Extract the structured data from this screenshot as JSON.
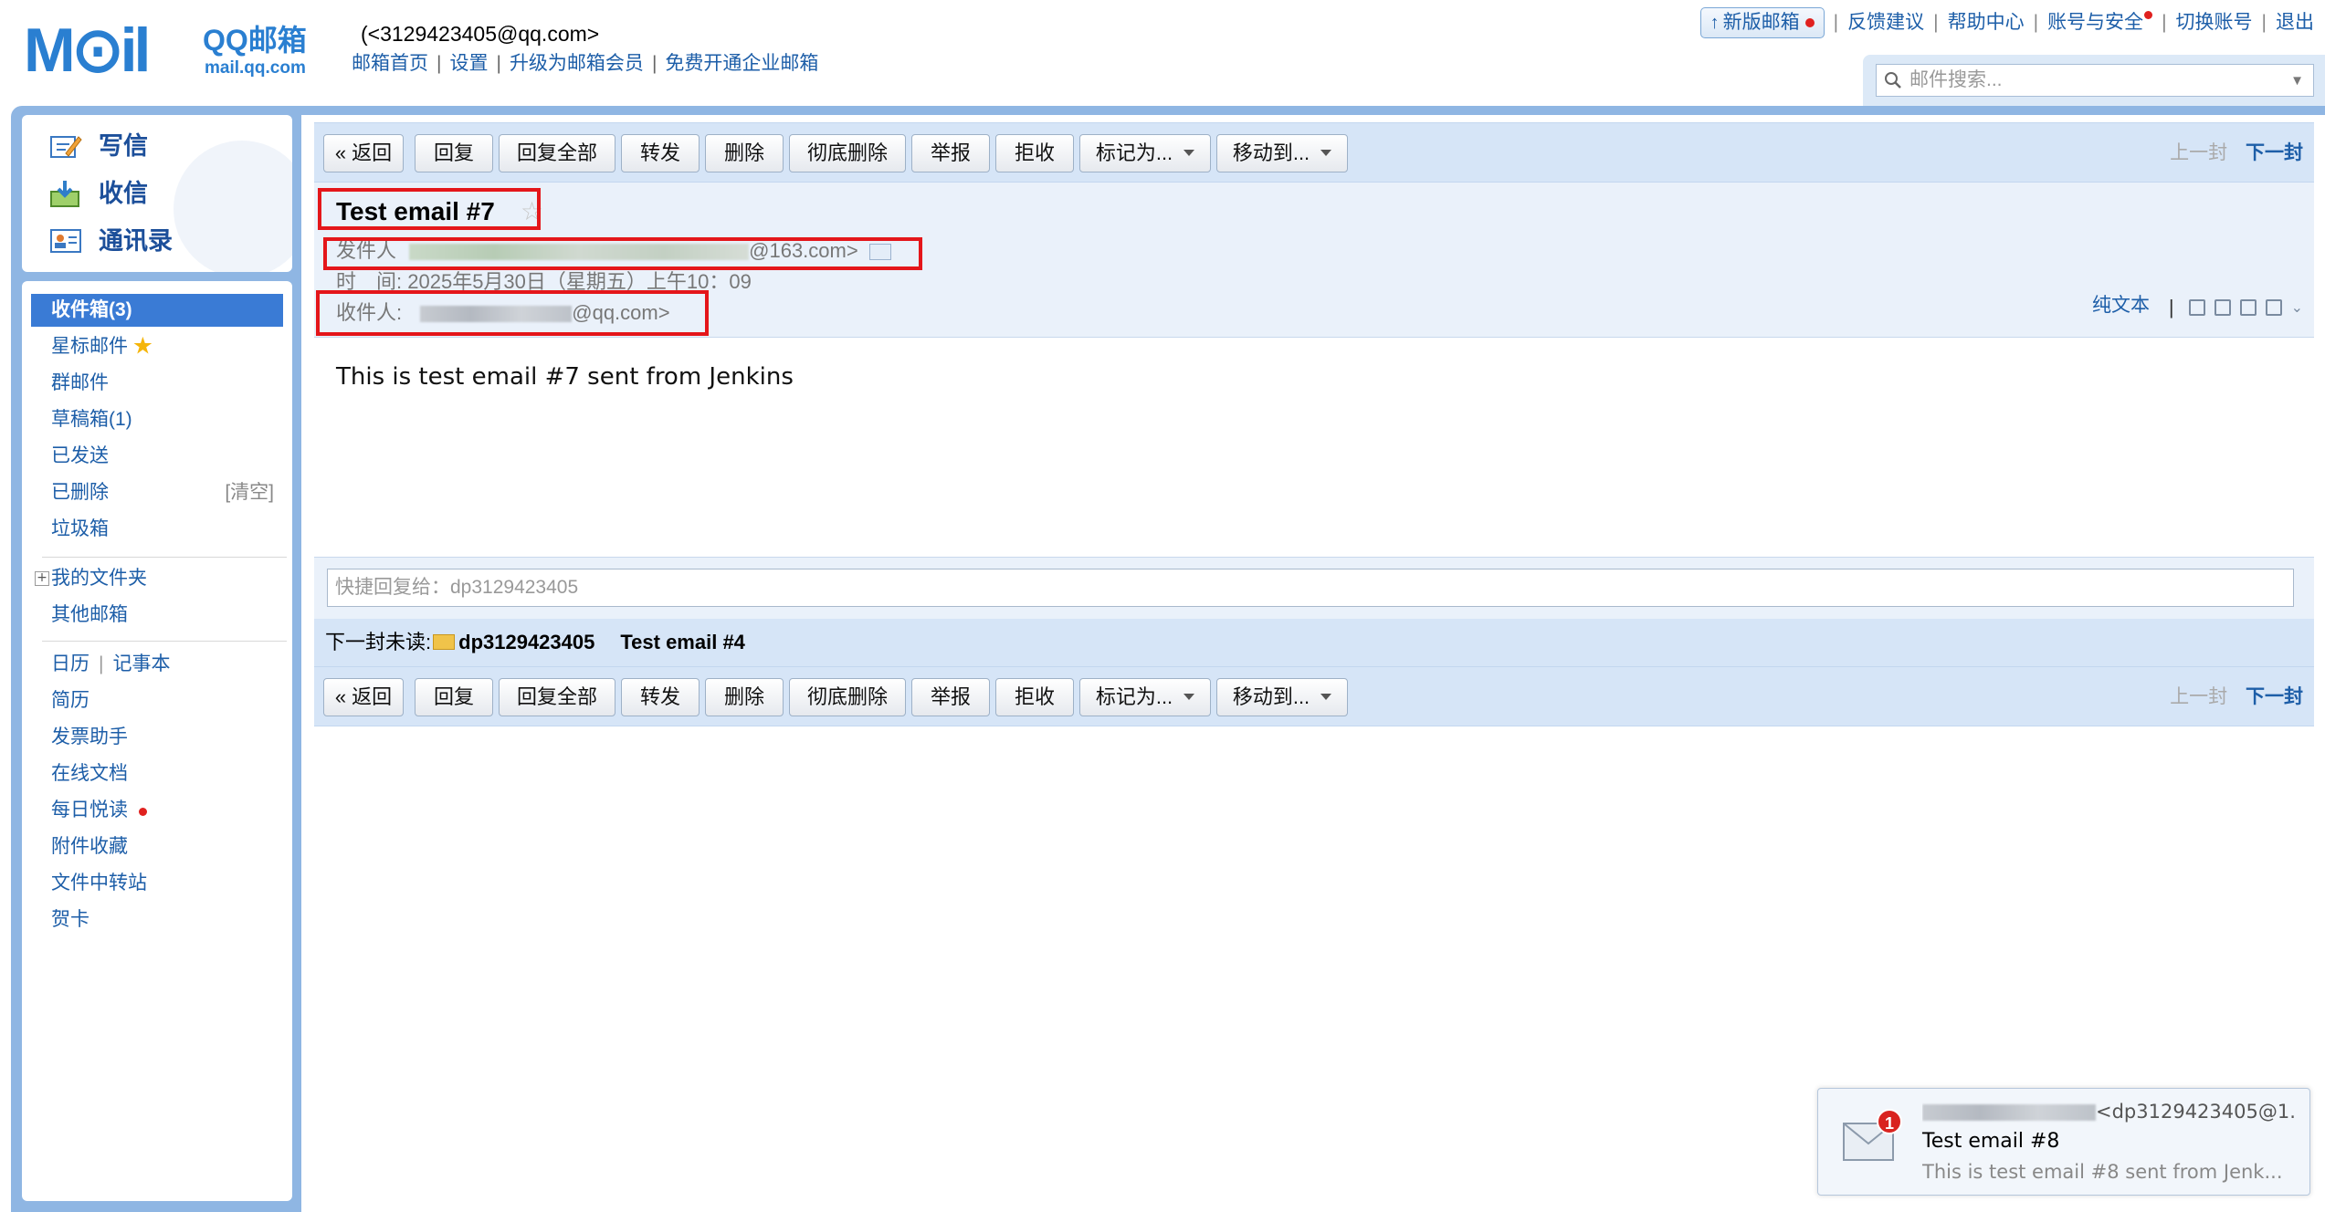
{
  "header": {
    "logo_mail": "M⊙il",
    "logo_qq": "QQ邮箱",
    "logo_domain": "mail.qq.com",
    "user_email": "(<3129423405@qq.com>",
    "links": [
      "邮箱首页",
      "设置",
      "升级为邮箱会员",
      "免费开通企业邮箱"
    ]
  },
  "utility": {
    "new_mail": "新版邮箱",
    "feedback": "反馈建议",
    "help": "帮助中心",
    "account_security": "账号与安全",
    "switch_account": "切换账号",
    "logout": "退出"
  },
  "search": {
    "placeholder": "邮件搜索..."
  },
  "quick_actions": {
    "compose": "写信",
    "receive": "收信",
    "contacts": "通讯录"
  },
  "folders": {
    "inbox": "收件箱(3)",
    "starred": "星标邮件",
    "group": "群邮件",
    "drafts": "草稿箱(1)",
    "sent": "已发送",
    "deleted": "已删除",
    "deleted_clear": "[清空]",
    "spam": "垃圾箱",
    "my_folders": "我的文件夹",
    "other_mailbox": "其他邮箱",
    "calendar": "日历",
    "notebook": "记事本",
    "resume": "简历",
    "invoice": "发票助手",
    "online_docs": "在线文档",
    "daily_reading": "每日悦读",
    "attachments": "附件收藏",
    "file_transfer": "文件中转站",
    "cards": "贺卡"
  },
  "toolbar": {
    "back": "« 返回",
    "reply": "回复",
    "reply_all": "回复全部",
    "forward": "转发",
    "delete": "删除",
    "delete_forever": "彻底删除",
    "report": "举报",
    "reject": "拒收",
    "mark_as": "标记为...",
    "move_to": "移动到...",
    "prev": "上一封",
    "next": "下一封"
  },
  "mail": {
    "subject": "Test email #7",
    "from_label": "发件人",
    "from_suffix": "@163.com>",
    "time_label": "时　间:",
    "time_value": "2025年5月30日（星期五）上午10：09",
    "to_label": "收件人:",
    "to_suffix": "@qq.com>",
    "plain_text": "纯文本",
    "body": "This is test email #7 sent from Jenkins"
  },
  "quick_reply": {
    "placeholder": "快捷回复给：dp3129423405"
  },
  "next_unread": {
    "label": "下一封未读:",
    "sender": "dp3129423405",
    "subject": "Test email #4"
  },
  "notification": {
    "count": "1",
    "from": "<dp3129423405@1...",
    "subject": "Test email #8",
    "preview": "This is test email #8 sent from Jenk..."
  },
  "colors": {
    "accent_blue": "#1d5ea8",
    "frame_blue": "#8fb6e3",
    "toolbar_bg": "#d6e5f7",
    "active_folder": "#3a7bd5",
    "highlight_red": "#e4161a"
  }
}
